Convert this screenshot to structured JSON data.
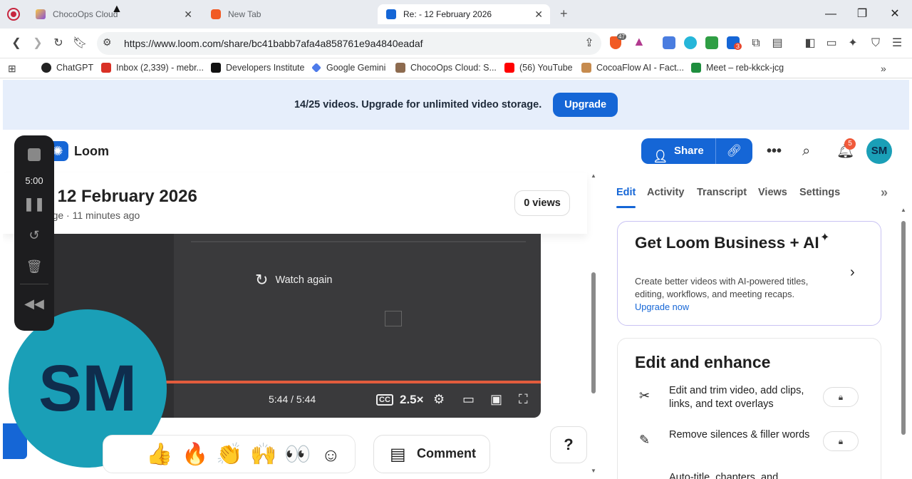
{
  "browser": {
    "tabs": [
      {
        "title": "ChocoOps Cloud",
        "active": false
      },
      {
        "title": "New Tab",
        "active": false
      },
      {
        "title": "Re: - 12 February 2026",
        "active": true
      }
    ],
    "url": "https://www.loom.com/share/bc41babb7afa4a858761e9a4840eadaf",
    "brave_badge": "47",
    "ext_badge": "3",
    "bookmarks": [
      "ChatGPT",
      "Inbox (2,339) - mebr...",
      "Developers Institute",
      "Google Gemini",
      "ChocoOps Cloud: S...",
      "(56) YouTube",
      "CocoaFlow AI - Fact...",
      "Meet – reb-kkck-jcg"
    ]
  },
  "banner": {
    "text": "14/25 videos. Upgrade for unlimited video storage.",
    "button": "Upgrade"
  },
  "header": {
    "brand": "Loom",
    "share_label": "Share",
    "notification_count": "5",
    "avatar_initials": "SM"
  },
  "video": {
    "title": "- 12 February 2026",
    "meta_prefix": "enge",
    "meta_time": "11 minutes ago",
    "views": "0 views",
    "watch_again": "Watch again",
    "time": "5:44 / 5:44",
    "speed": "2.5×",
    "cc": "CC"
  },
  "recorder": {
    "timer": "5:00",
    "camera_initials": "SM"
  },
  "reactions": [
    "👍",
    "🔥",
    "👏",
    "🙌",
    "👀"
  ],
  "comment_label": "Comment",
  "help_label": "?",
  "panel": {
    "tabs": [
      "Edit",
      "Activity",
      "Transcript",
      "Views",
      "Settings"
    ],
    "promo": {
      "title": "Get Loom Business + AI",
      "subtitle": "Create better videos with AI-powered titles, editing, workflows, and meeting recaps.",
      "link": "Upgrade now"
    },
    "enhance": {
      "title": "Edit and enhance",
      "features": [
        "Edit and trim video, add clips, links, and text overlays",
        "Remove silences & filler words",
        "Auto-title, chapters, and"
      ]
    }
  },
  "colors": {
    "accent": "#1566d6",
    "avatar": "#1a9fb7",
    "progress": "#e25c3d"
  }
}
